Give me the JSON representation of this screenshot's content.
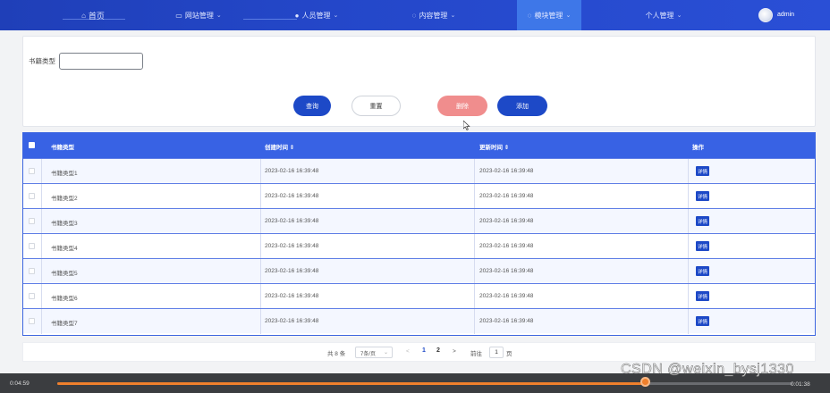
{
  "nav": {
    "items": [
      {
        "label": "首页",
        "icon": "home-icon"
      },
      {
        "label": "网站管理",
        "icon": "monitor-icon"
      },
      {
        "label": "人员管理",
        "icon": "user-icon"
      },
      {
        "label": "内容管理",
        "icon": "chat-icon"
      },
      {
        "label": "模块管理",
        "icon": "sync-icon"
      },
      {
        "label": "个人管理",
        "icon": ""
      }
    ],
    "user": "admin"
  },
  "search": {
    "label": "书籍类型",
    "value": "",
    "buttons": {
      "query": "查询",
      "reset": "重置",
      "delete": "删除",
      "add": "添加"
    }
  },
  "table": {
    "columns": [
      "书籍类型",
      "创建时间 ⇕",
      "更新时间 ⇕",
      "操作"
    ],
    "detail_label": "详情",
    "rows": [
      {
        "type": "书籍类型1",
        "created": "2023-02-16 16:39:48",
        "updated": "2023-02-16 16:39:48"
      },
      {
        "type": "书籍类型2",
        "created": "2023-02-16 16:39:48",
        "updated": "2023-02-16 16:39:48"
      },
      {
        "type": "书籍类型3",
        "created": "2023-02-16 16:39:48",
        "updated": "2023-02-16 16:39:48"
      },
      {
        "type": "书籍类型4",
        "created": "2023-02-16 16:39:48",
        "updated": "2023-02-16 16:39:48"
      },
      {
        "type": "书籍类型5",
        "created": "2023-02-16 16:39:48",
        "updated": "2023-02-16 16:39:48"
      },
      {
        "type": "书籍类型6",
        "created": "2023-02-16 16:39:48",
        "updated": "2023-02-16 16:39:48"
      },
      {
        "type": "书籍类型7",
        "created": "2023-02-16 16:39:48",
        "updated": "2023-02-16 16:39:48"
      }
    ]
  },
  "pagination": {
    "total": "共 8 条",
    "page_size": "7条/页",
    "prev": "<",
    "pages": [
      "1",
      "2"
    ],
    "next": ">",
    "goto": "前往",
    "goto_value": "1",
    "page_unit": "页"
  },
  "video": {
    "current": "0:04:59",
    "total": "0:01:38",
    "progress": 0.8,
    "watermark": "CSDN @weixin_bysj1330"
  },
  "colors": {
    "primary": "#1d49c7",
    "header": "#3862e4",
    "danger": "#f08d8d",
    "progress": "#ef7f2c"
  }
}
